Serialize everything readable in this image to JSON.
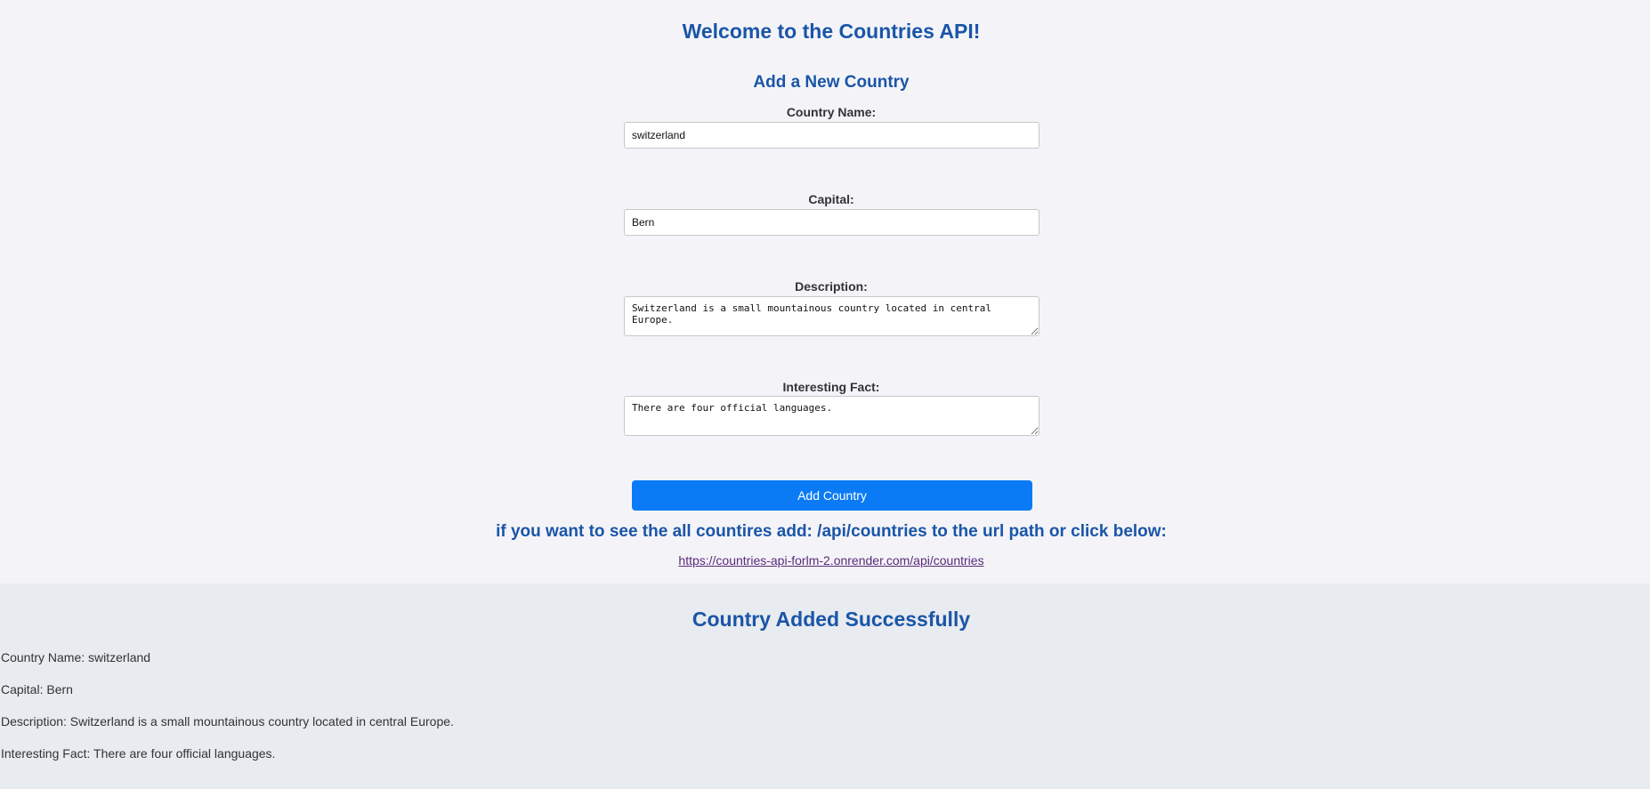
{
  "header": {
    "title": "Welcome to the Countries API!"
  },
  "form": {
    "title": "Add a New Country",
    "fields": [
      {
        "label": "Country Name:",
        "value": "switzerland"
      },
      {
        "label": "Capital:",
        "value": "Bern"
      },
      {
        "label": "Description:",
        "value": "Switzerland is a small mountainous country located in central Europe."
      },
      {
        "label": "Interesting Fact:",
        "value": "There are four official languages."
      }
    ],
    "submit_label": "Add Country"
  },
  "hint": {
    "text": "if you want to see the all countires add: /api/countries to the url path or click below:",
    "link_text": "https://countries-api-forlm-2.onrender.com/api/countries"
  },
  "result": {
    "title": "Country Added Successfully",
    "lines": [
      "Country Name: switzerland",
      "Capital: Bern",
      "Description: Switzerland is a small mountainous country located in central Europe.",
      "Interesting Fact: There are four official languages."
    ]
  },
  "colors": {
    "heading": "#1a55a8",
    "button": "#0a7bf5",
    "link_visited": "#5a2a7a",
    "page_background": "#f4f4f8",
    "result_background": "#e8ebef"
  }
}
